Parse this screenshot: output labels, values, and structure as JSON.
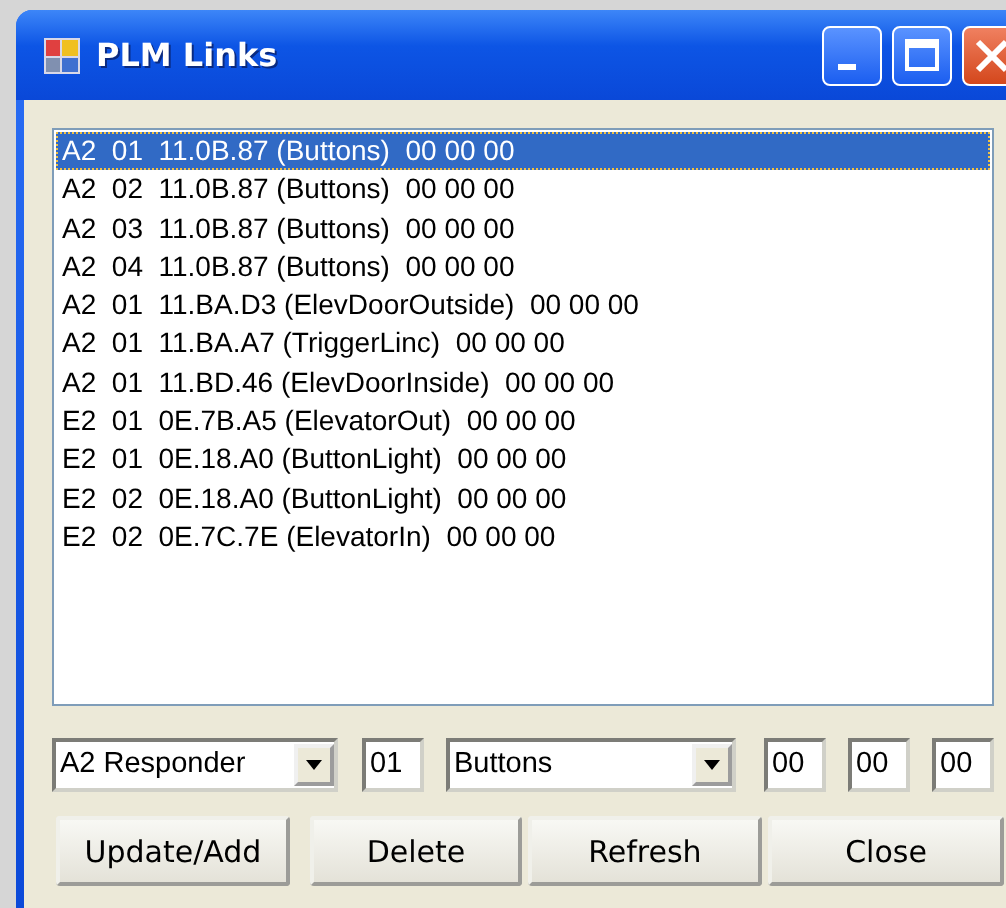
{
  "window": {
    "title": "PLM Links"
  },
  "links": [
    {
      "text": "A2  01  11.0B.87 (Buttons)  00 00 00",
      "selected": true
    },
    {
      "text": "A2  02  11.0B.87 (Buttons)  00 00 00",
      "selected": false
    },
    {
      "text": "A2  03  11.0B.87 (Buttons)  00 00 00",
      "selected": false
    },
    {
      "text": "A2  04  11.0B.87 (Buttons)  00 00 00",
      "selected": false
    },
    {
      "text": "A2  01  11.BA.D3 (ElevDoorOutside)  00 00 00",
      "selected": false
    },
    {
      "text": "A2  01  11.BA.A7 (TriggerLinc)  00 00 00",
      "selected": false
    },
    {
      "text": "A2  01  11.BD.46 (ElevDoorInside)  00 00 00",
      "selected": false
    },
    {
      "text": "E2  01  0E.7B.A5 (ElevatorOut)  00 00 00",
      "selected": false
    },
    {
      "text": "E2  01  0E.18.A0 (ButtonLight)  00 00 00",
      "selected": false
    },
    {
      "text": "E2  02  0E.18.A0 (ButtonLight)  00 00 00",
      "selected": false
    },
    {
      "text": "E2  02  0E.7C.7E (ElevatorIn)  00 00 00",
      "selected": false
    }
  ],
  "editor": {
    "link_type": "A2 Responder",
    "group": "01",
    "device": "Buttons",
    "data_1": "00",
    "data_2": "00",
    "data_3": "00"
  },
  "buttons": [
    "Update/Add",
    "Delete",
    "Refresh",
    "Close"
  ]
}
